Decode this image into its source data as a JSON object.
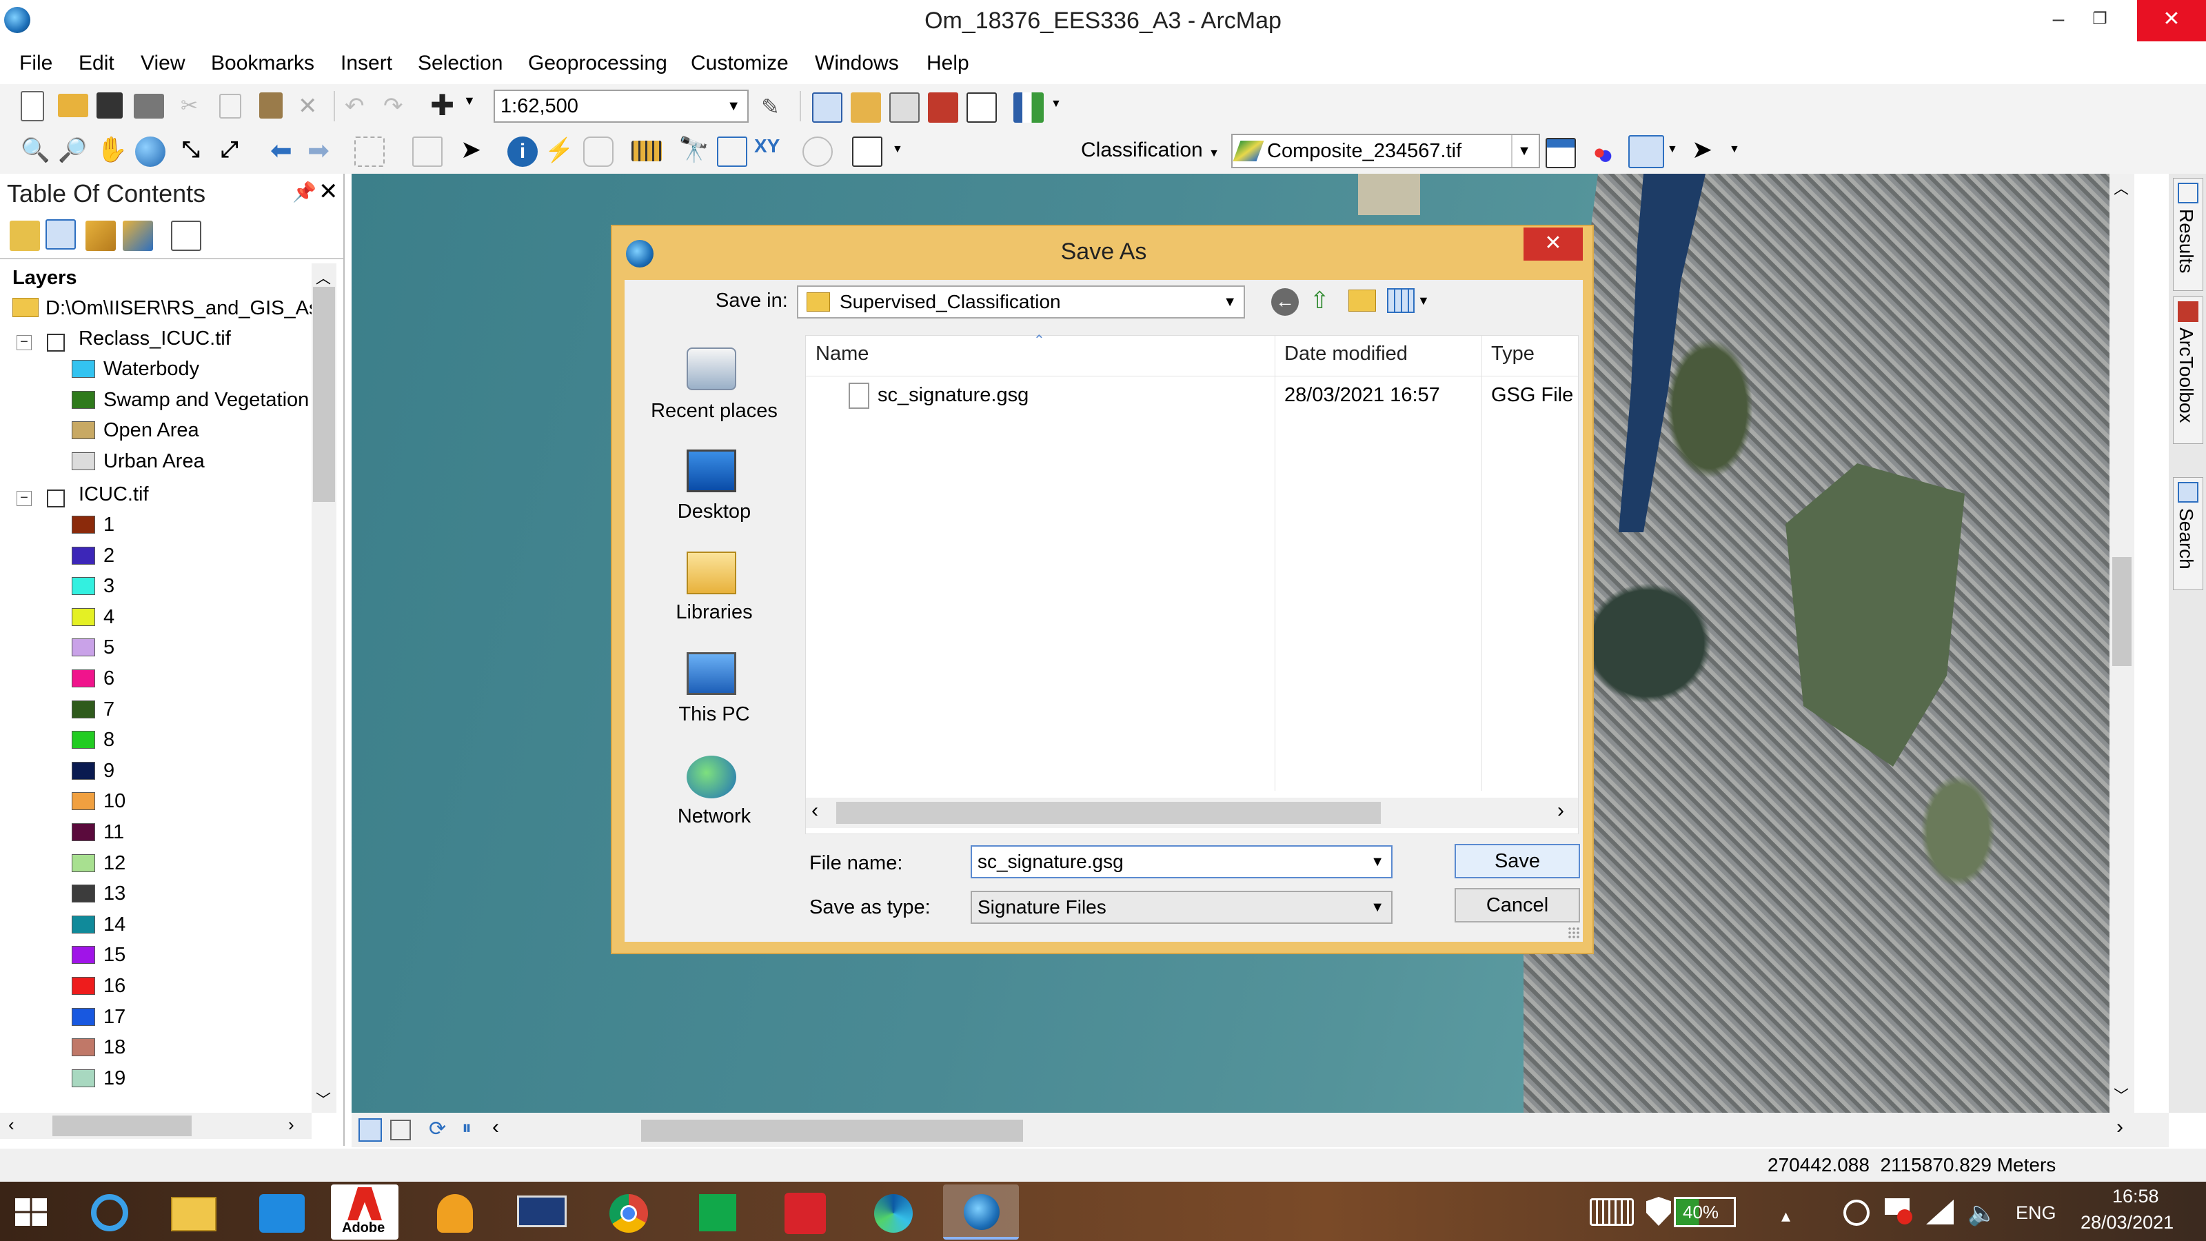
{
  "window": {
    "title": "Om_18376_EES336_A3 - ArcMap"
  },
  "menu": [
    "File",
    "Edit",
    "View",
    "Bookmarks",
    "Insert",
    "Selection",
    "Geoprocessing",
    "Customize",
    "Windows",
    "Help"
  ],
  "toolbar": {
    "scale": "1:62,500",
    "classification_label": "Classification",
    "layer_select": "Composite_234567.tif"
  },
  "toc": {
    "title": "Table Of Contents",
    "layers_label": "Layers",
    "folder_path": "D:\\Om\\IISER\\RS_and_GIS_Ass",
    "layer1": {
      "name": "Reclass_ICUC.tif",
      "classes": [
        {
          "label": "Waterbody",
          "color": "#33c3f0"
        },
        {
          "label": "Swamp and Vegetation",
          "color": "#2f7a1c"
        },
        {
          "label": "Open Area",
          "color": "#c8a964"
        },
        {
          "label": "Urban Area",
          "color": "#dcdcdc"
        }
      ]
    },
    "layer2": {
      "name": "ICUC.tif",
      "classes": [
        {
          "label": "1",
          "color": "#8b2a0b"
        },
        {
          "label": "2",
          "color": "#3c26b8"
        },
        {
          "label": "3",
          "color": "#33f0e0"
        },
        {
          "label": "4",
          "color": "#e4f024"
        },
        {
          "label": "5",
          "color": "#c9a2e8"
        },
        {
          "label": "6",
          "color": "#f0148c"
        },
        {
          "label": "7",
          "color": "#2f5a1c"
        },
        {
          "label": "8",
          "color": "#22cc22"
        },
        {
          "label": "9",
          "color": "#0a1a50"
        },
        {
          "label": "10",
          "color": "#f0a040"
        },
        {
          "label": "11",
          "color": "#5a0a3c"
        },
        {
          "label": "12",
          "color": "#a8e090"
        },
        {
          "label": "13",
          "color": "#3c3c3c"
        },
        {
          "label": "14",
          "color": "#108a9a"
        },
        {
          "label": "15",
          "color": "#a014e8"
        },
        {
          "label": "16",
          "color": "#ee1c1c"
        },
        {
          "label": "17",
          "color": "#1858e0"
        },
        {
          "label": "18",
          "color": "#c07868"
        },
        {
          "label": "19",
          "color": "#a8d8c0"
        }
      ]
    }
  },
  "dialog": {
    "title": "Save As",
    "save_in_label": "Save in:",
    "save_in_value": "Supervised_Classification",
    "places": [
      "Recent places",
      "Desktop",
      "Libraries",
      "This PC",
      "Network"
    ],
    "columns": [
      "Name",
      "Date modified",
      "Type"
    ],
    "files": [
      {
        "name": "sc_signature.gsg",
        "date": "28/03/2021 16:57",
        "type": "GSG File"
      }
    ],
    "file_name_label": "File name:",
    "file_name_value": "sc_signature.gsg",
    "save_as_type_label": "Save as type:",
    "save_as_type_value": "Signature Files",
    "save_button": "Save",
    "cancel_button": "Cancel"
  },
  "status": {
    "coordinates": "270442.088  2115870.829 Meters"
  },
  "side_tabs": [
    "Results",
    "ArcToolbox",
    "Search"
  ],
  "taskbar": {
    "battery": "40%",
    "language": "ENG",
    "time": "16:58",
    "date": "28/03/2021",
    "adobe_label": "Adobe"
  }
}
